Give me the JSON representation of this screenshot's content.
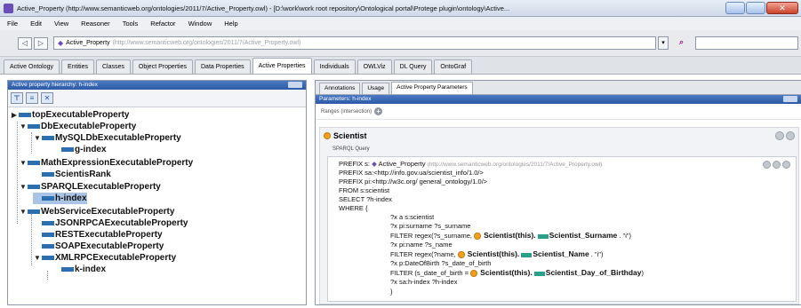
{
  "window": {
    "title": "Active_Property (http://www.semanticweb.org/ontologies/2011/7/Active_Property.owl) - [D:\\work\\work root repository\\Ontological portal\\Protege plugin\\ontology\\Active..."
  },
  "menu": [
    "File",
    "Edit",
    "View",
    "Reasoner",
    "Tools",
    "Refactor",
    "Window",
    "Help"
  ],
  "address": {
    "back": "◁",
    "forward": "▷",
    "ontology_name": "Active_Property",
    "ontology_url": "(http://www.semanticweb.org/ontologies/2011/7/Active_Property.owl)",
    "dropdown": "▾"
  },
  "tabs": [
    "Active Ontology",
    "Entities",
    "Classes",
    "Object Properties",
    "Data Properties",
    "Active Properties",
    "Individuals",
    "OWLViz",
    "DL Query",
    "OntoGraf"
  ],
  "active_tab": "Active Properties",
  "left_panel": {
    "header": "Active property hierarchy: h-index",
    "tree": [
      {
        "label": "topExecutableProperty",
        "arrow": "▶"
      },
      {
        "label": "DbExecutableProperty",
        "arrow": "▼"
      },
      {
        "label": "MySQLDbExecutableProperty",
        "arrow": "▼"
      },
      {
        "label": "g-index",
        "arrow": ""
      },
      {
        "label": "MathExpressionExecutableProperty",
        "arrow": "▼"
      },
      {
        "label": "ScientisRank",
        "arrow": ""
      },
      {
        "label": "SPARQLExecutableProperty",
        "arrow": "▼"
      },
      {
        "label": "h-index",
        "arrow": ""
      },
      {
        "label": "WebServiceExecutableProperty",
        "arrow": "▼"
      },
      {
        "label": "JSONRPCAExecutableProperty",
        "arrow": ""
      },
      {
        "label": "RESTExecutableProperty",
        "arrow": ""
      },
      {
        "label": "SOAPExecutableProperty",
        "arrow": ""
      },
      {
        "label": "XMLRPCExecutableProperty",
        "arrow": "▼"
      },
      {
        "label": "k-index",
        "arrow": ""
      }
    ]
  },
  "right_panel": {
    "subtabs": [
      "Annotations",
      "Usage",
      "Active Property Parameters"
    ],
    "params_header": "Parameters: h-index",
    "ranges_label": "Ranges (intersection)",
    "scientist_label": "Scientist",
    "sparql_label": "SPARQL Query",
    "query": {
      "l1_prefix": "PREFIX s:",
      "l1_name": "Active_Property",
      "l1_url": "(http://www.semanticweb.org/ontologies/2011/7/Active_Property.owl)",
      "l2": "PREFIX sa:<http://info.gov.ua/scientist_info/1.0/>",
      "l3": "PREFIX pi:<http://w3c.org/ general_ontology/1.0/>",
      "l4": "FROM s:scientist",
      "l5": "SELECT ?h-index",
      "l6": "WHERE  {",
      "l7": "?x a s:scientist",
      "l8": "?x pi:surname ?s_surname",
      "l9_pre": "FILTER regex(?s_surname,",
      "l9_cls": "Scientist(this).",
      "l9_prop": "Scientist_Surname",
      "l9_post": ". \"i\")",
      "l10": "?x pi:name ?s_name",
      "l11_pre": "FILTER regex(?name,",
      "l11_cls": "Scientist(this).",
      "l11_prop": "Scientist_Name",
      "l11_post": ". \"i\")",
      "l12": "?x p:DateOfBirth ?s_date_of_birth",
      "l13_pre": "FILTER (s_date_of_birth =",
      "l13_cls": "Scientist(this).",
      "l13_prop": "Scientist_Day_of_Birthday",
      "l13_post": ")",
      "l14": "?x sa:h-index ?h-index",
      "l15": "}"
    }
  }
}
